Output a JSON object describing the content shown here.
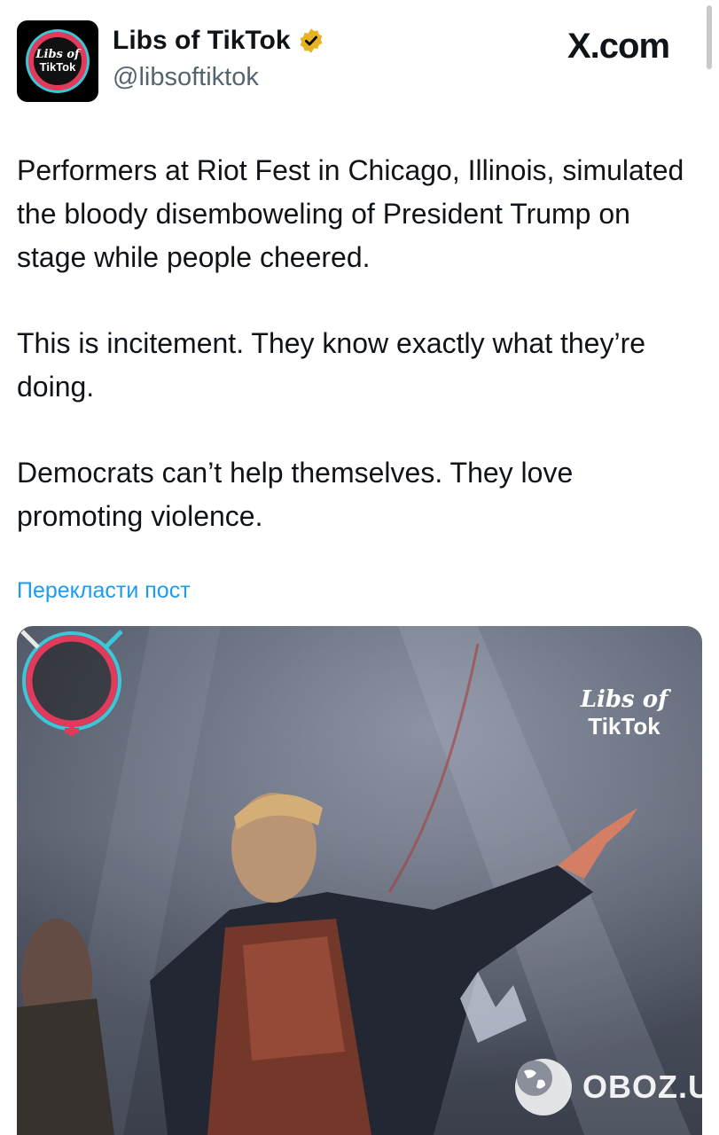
{
  "header": {
    "display_name": "Libs of TikTok",
    "handle": "@libsoftiktok",
    "site_label": "X.com",
    "avatar_line1": "Libs of",
    "avatar_line2": "TikTok",
    "verified_color": "#e8b323"
  },
  "tweet": {
    "paragraphs": [
      "Performers at Riot Fest in Chicago, Illinois, simulated the bloody disemboweling of President Trump on stage while people cheered.",
      "This is incitement. They know exactly what they’re doing.",
      "Democrats can’t help themselves. They love promoting violence."
    ],
    "translate_link": "Перекласти пост"
  },
  "media": {
    "watermark_line1": "Libs of",
    "watermark_line2": "TikTok",
    "source_watermark": "OBOZ.UA"
  },
  "icons": [
    "verified-badge-icon",
    "globe-icon",
    "gender-symbol-icon"
  ],
  "colors": {
    "link": "#1d9bf0",
    "text": "#0f1419",
    "secondary": "#536471",
    "logo_pink": "#e23a5a",
    "logo_teal": "#3cc6d8"
  }
}
